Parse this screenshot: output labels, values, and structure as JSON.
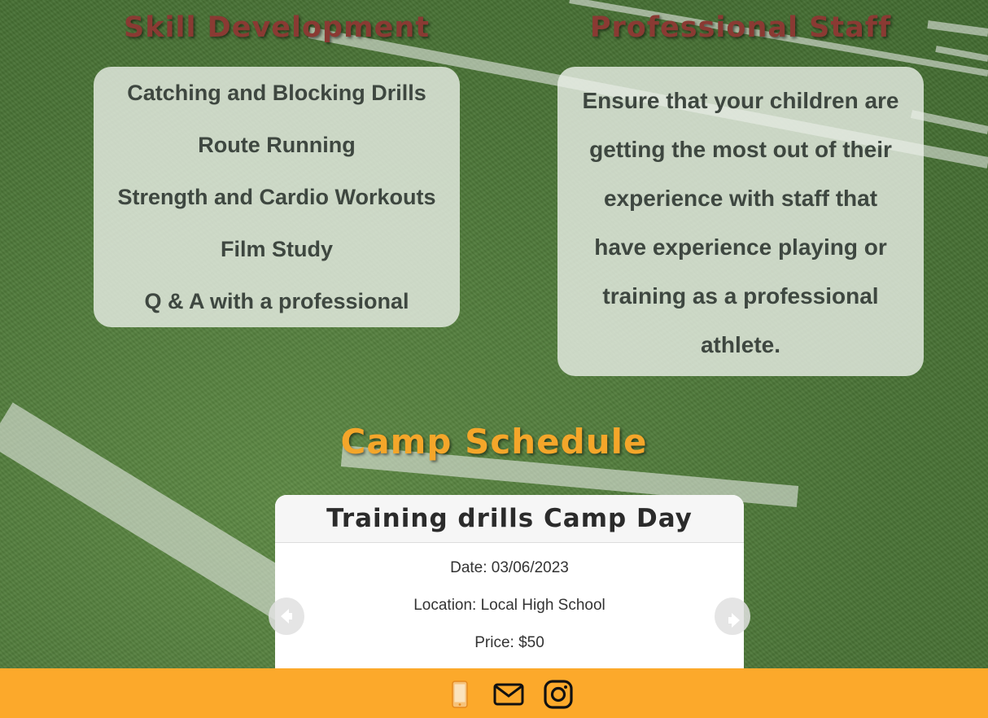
{
  "skill_development": {
    "title": "Skill Development",
    "items": [
      "Catching and Blocking Drills",
      "Route Running",
      "Strength and Cardio Workouts",
      "Film Study",
      "Q & A with a professional"
    ]
  },
  "professional_staff": {
    "title": "Professional Staff",
    "lines": [
      "Ensure that your children are",
      "getting the most out of their",
      "experience with staff that",
      "have experience playing or",
      "training as a professional",
      "athlete."
    ]
  },
  "schedule": {
    "title": "Camp Schedule",
    "event": {
      "name": "Training drills Camp Day",
      "date": "Date: 03/06/2023",
      "location": "Location: Local High School",
      "price": "Price: $50"
    }
  },
  "footer": {
    "icons": [
      "phone-icon",
      "mail-icon",
      "instagram-icon"
    ]
  },
  "colors": {
    "section_title": "#8a3a33",
    "schedule_title": "#f4a62a",
    "footer_bg": "#fca92b",
    "card_text": "#3e4740"
  }
}
